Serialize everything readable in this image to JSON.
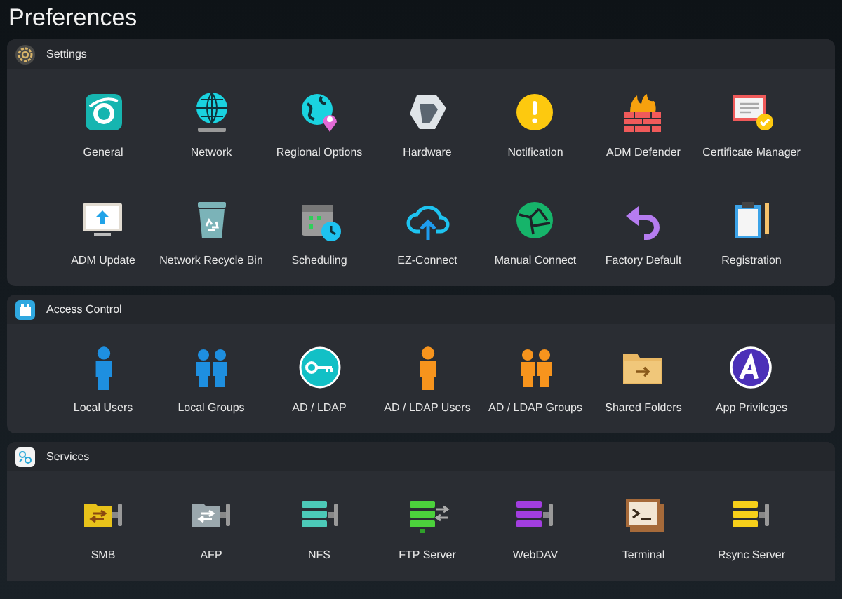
{
  "window": {
    "title": "Preferences"
  },
  "sections": [
    {
      "title": "Settings",
      "items": [
        {
          "label": "General"
        },
        {
          "label": "Network"
        },
        {
          "label": "Regional Options"
        },
        {
          "label": "Hardware"
        },
        {
          "label": "Notification"
        },
        {
          "label": "ADM Defender"
        },
        {
          "label": "Certificate Manager"
        },
        {
          "label": "ADM Update"
        },
        {
          "label": "Network Recycle Bin"
        },
        {
          "label": "Scheduling"
        },
        {
          "label": "EZ-Connect"
        },
        {
          "label": "Manual Connect"
        },
        {
          "label": "Factory Default"
        },
        {
          "label": "Registration"
        }
      ]
    },
    {
      "title": "Access Control",
      "items": [
        {
          "label": "Local Users"
        },
        {
          "label": "Local Groups"
        },
        {
          "label": "AD / LDAP"
        },
        {
          "label": "AD / LDAP Users"
        },
        {
          "label": "AD / LDAP Groups"
        },
        {
          "label": "Shared Folders"
        },
        {
          "label": "App Privileges"
        }
      ]
    },
    {
      "title": "Services",
      "items": [
        {
          "label": "SMB"
        },
        {
          "label": "AFP"
        },
        {
          "label": "NFS"
        },
        {
          "label": "FTP Server"
        },
        {
          "label": "WebDAV"
        },
        {
          "label": "Terminal"
        },
        {
          "label": "Rsync Server"
        }
      ]
    }
  ]
}
